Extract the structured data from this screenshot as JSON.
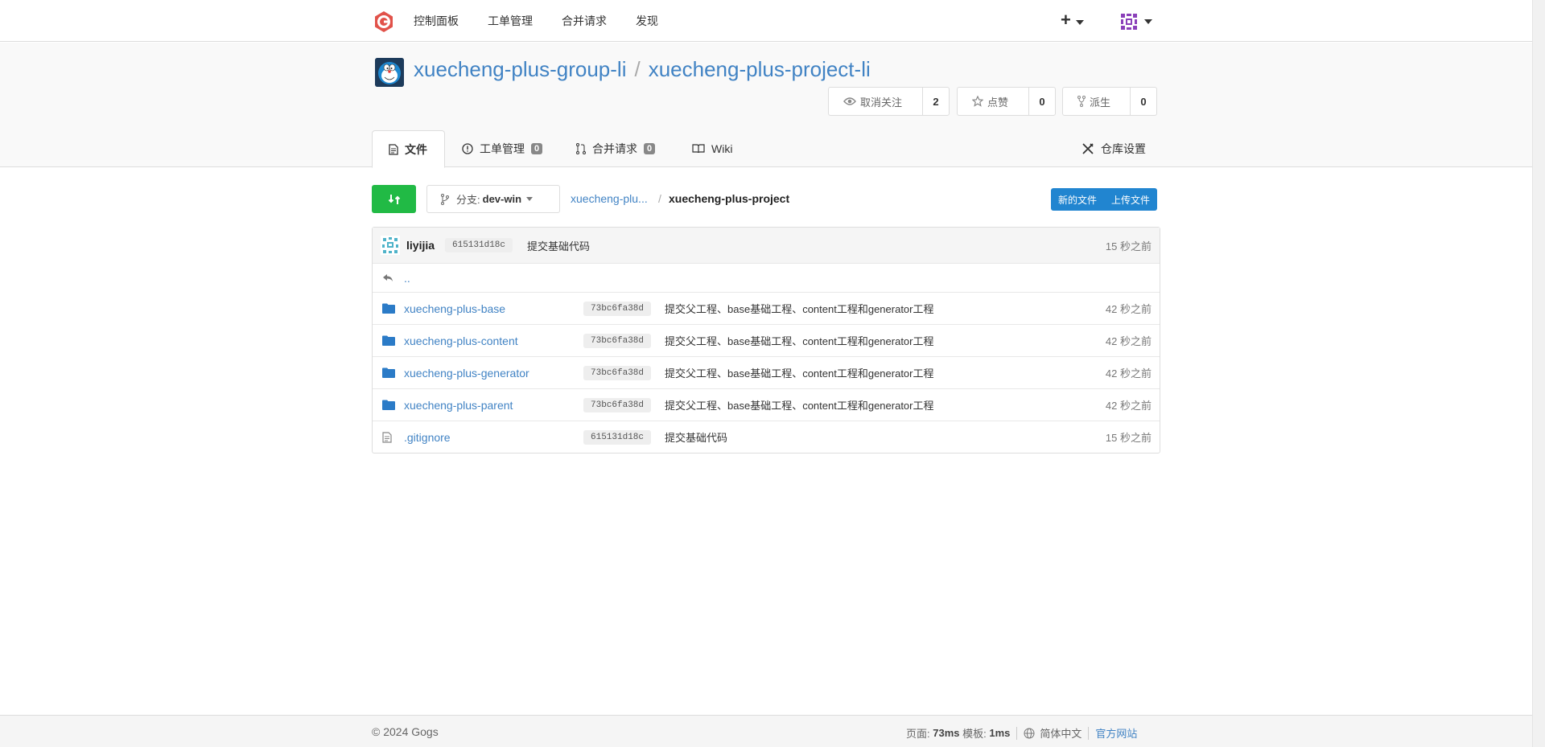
{
  "nav": {
    "items": [
      "控制面板",
      "工单管理",
      "合并请求",
      "发现"
    ],
    "plus_icon": "plus-icon",
    "avatar_icon": "user-avatar-icon"
  },
  "repo": {
    "owner": "xuecheng-plus-group-li",
    "separator": "/",
    "name": "xuecheng-plus-project-li",
    "watch_label": "取消关注",
    "watch_count": "2",
    "star_label": "点赞",
    "star_count": "0",
    "fork_label": "派生",
    "fork_count": "0"
  },
  "tabs": {
    "files": "文件",
    "issues": "工单管理",
    "issues_count": "0",
    "pulls": "合并请求",
    "pulls_count": "0",
    "wiki": "Wiki",
    "settings": "仓库设置"
  },
  "toolbar": {
    "branch_prefix": "分支:",
    "branch_name": "dev-win",
    "crumb_root": "xuecheng-plu...",
    "crumb_sep": "/",
    "crumb_current": "xuecheng-plus-project",
    "new_file": "新的文件",
    "upload_file": "上传文件"
  },
  "latest_commit": {
    "author": "liyijia",
    "sha": "615131d18c",
    "message": "提交基础代码",
    "time": "15 秒之前"
  },
  "parent_link": "..",
  "files": [
    {
      "type": "folder",
      "name": "xuecheng-plus-base",
      "sha": "73bc6fa38d",
      "message": "提交父工程、base基础工程、content工程和generator工程",
      "time": "42 秒之前"
    },
    {
      "type": "folder",
      "name": "xuecheng-plus-content",
      "sha": "73bc6fa38d",
      "message": "提交父工程、base基础工程、content工程和generator工程",
      "time": "42 秒之前"
    },
    {
      "type": "folder",
      "name": "xuecheng-plus-generator",
      "sha": "73bc6fa38d",
      "message": "提交父工程、base基础工程、content工程和generator工程",
      "time": "42 秒之前"
    },
    {
      "type": "folder",
      "name": "xuecheng-plus-parent",
      "sha": "73bc6fa38d",
      "message": "提交父工程、base基础工程、content工程和generator工程",
      "time": "42 秒之前"
    },
    {
      "type": "file",
      "name": ".gitignore",
      "sha": "615131d18c",
      "message": "提交基础代码",
      "time": "15 秒之前"
    }
  ],
  "footer": {
    "copyright": "© 2024 Gogs",
    "page_label": "页面:",
    "page_time": "73ms",
    "template_label": "模板:",
    "template_time": "1ms",
    "language": "简体中文",
    "website": "官方网站"
  },
  "colors": {
    "link": "#4183c4",
    "green": "#21ba45",
    "blue": "#2185d0",
    "logo": "#e1524a"
  }
}
